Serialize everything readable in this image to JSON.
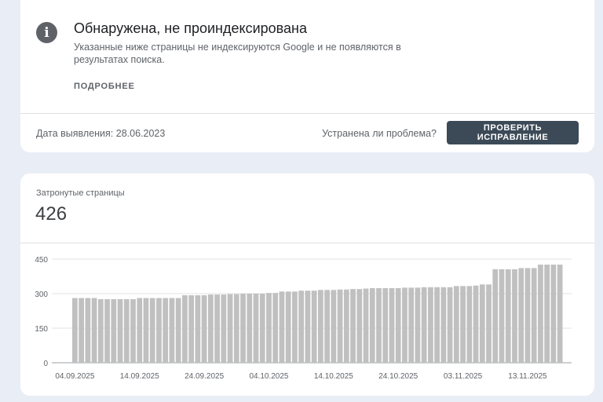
{
  "issue": {
    "icon": "info-icon",
    "title": "Обнаружена, не проиндексирована",
    "description": "Указанные ниже страницы не индексируются Google и не появляются в результатах поиска.",
    "more_label": "ПОДРОБНЕЕ",
    "detected_date": "Дата выявления: 28.06.2023",
    "fixed_question": "Устранена ли проблема?",
    "validate_label": "ПРОВЕРИТЬ ИСПРАВЛЕНИЕ"
  },
  "affected": {
    "label": "Затронутые страницы",
    "count": "426"
  },
  "colors": {
    "bar": "#c0c0c0",
    "button": "#3c4a57",
    "background": "#e9eef6"
  },
  "chart_data": {
    "type": "bar",
    "ylim": [
      0,
      450
    ],
    "yticks": [
      "450",
      "300",
      "150",
      "0"
    ],
    "xtick_labels": [
      "04.09.2025",
      "14.09.2025",
      "24.09.2025",
      "04.10.2025",
      "14.10.2025",
      "24.10.2025",
      "03.11.2025",
      "13.11.2025"
    ],
    "grid": true,
    "values": [
      281,
      281,
      281,
      281,
      276,
      276,
      276,
      276,
      276,
      276,
      281,
      281,
      281,
      281,
      281,
      281,
      281,
      293,
      293,
      293,
      293,
      296,
      296,
      296,
      298,
      298,
      300,
      300,
      300,
      300,
      303,
      303,
      309,
      309,
      309,
      313,
      313,
      313,
      316,
      316,
      316,
      318,
      318,
      320,
      320,
      322,
      324,
      324,
      324,
      324,
      324,
      326,
      326,
      326,
      328,
      328,
      328,
      328,
      328,
      333,
      333,
      333,
      335,
      340,
      340,
      406,
      406,
      406,
      406,
      411,
      411,
      411,
      426,
      426,
      426,
      426
    ]
  }
}
